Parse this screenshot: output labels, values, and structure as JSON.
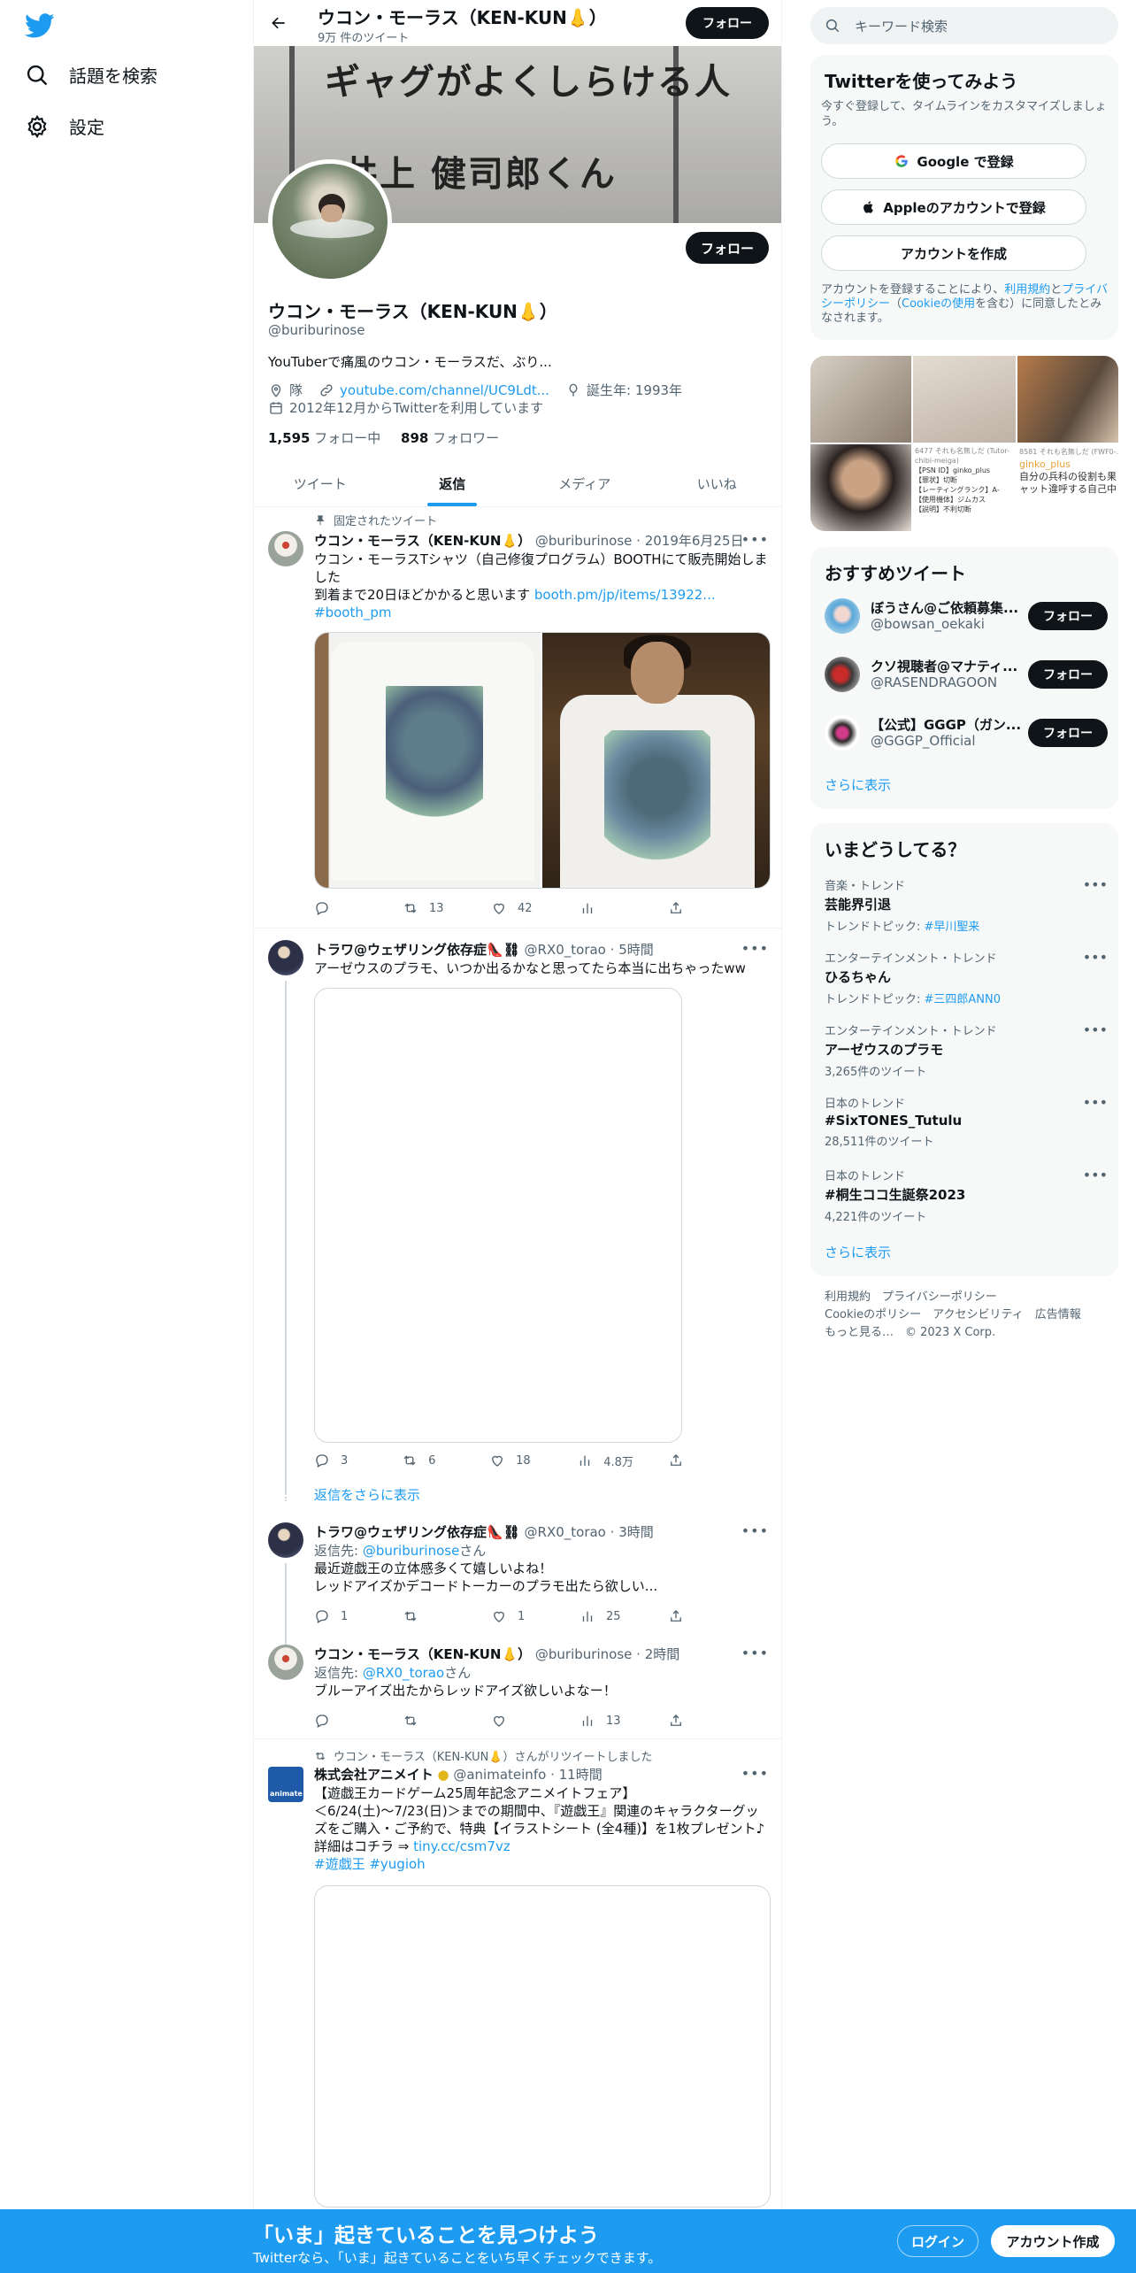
{
  "nav": {
    "explore": "話題を検索",
    "settings": "設定"
  },
  "topbar": {
    "name": "ウコン・モーラス（KEN-KUN👃）",
    "tweet_count": "9万 件のツイート",
    "follow": "フォロー"
  },
  "banner": {
    "line1": "ギャグがよくしらける人",
    "line2": "井上 健司郎くん"
  },
  "profile": {
    "follow": "フォロー",
    "name": "ウコン・モーラス（KEN-KUN👃）",
    "handle": "@buriburinose",
    "bio": "YouTuberで痛風のウコン・モーラスだ、ぶり...",
    "location": "隊",
    "url": "youtube.com/channel/UC9Ldt...",
    "birthday": "誕生年: 1993年",
    "joined": "2012年12月からTwitterを利用しています",
    "following_count": "1,595",
    "following_label": "フォロー中",
    "followers_count": "898",
    "followers_label": "フォロワー"
  },
  "tabs": [
    "ツイート",
    "返信",
    "メディア",
    "いいね"
  ],
  "tweets": [
    {
      "context": "固定されたツイート",
      "name": "ウコン・モーラス（KEN-KUN👃）",
      "handle": "@buriburinose",
      "time": "2019年6月25日",
      "text1": "ウコン・モーラスTシャツ（自己修復プログラム）BOOTHにて販売開始しました",
      "text2": "到着まで20日ほどかかると思います",
      "link": "booth.pm/jp/items/13922...",
      "hashtag": "#booth_pm",
      "reply": "",
      "retweet": "13",
      "like": "42",
      "views": ""
    },
    {
      "name": "トラワ@ウェザリング依存症👠⛓",
      "handle": "@RX0_torao",
      "time": "5時間",
      "text1": "アーゼウスのプラモ、いつか出るかなと思ってたら本当に出ちゃったww",
      "reply": "3",
      "retweet": "6",
      "like": "18",
      "views": "4.8万"
    },
    {
      "more_replies": "返信をさらに表示"
    },
    {
      "name": "トラワ@ウェザリング依存症👠⛓",
      "handle": "@RX0_torao",
      "time": "3時間",
      "reply_to_label": "返信先:",
      "reply_to": "@buriburinose",
      "reply_to_suffix": "さん",
      "text1": "最近遊戯王の立体感多くて嬉しいよね！",
      "text2": "レッドアイズかデコードトーカーのプラモ出たら欲しい...",
      "reply": "1",
      "retweet": "",
      "like": "1",
      "views": "25"
    },
    {
      "name": "ウコン・モーラス（KEN-KUN👃）",
      "handle": "@buriburinose",
      "time": "2時間",
      "reply_to_label": "返信先:",
      "reply_to": "@RX0_torao",
      "reply_to_suffix": "さん",
      "text1": "ブルーアイズ出たからレッドアイズ欲しいよなー！",
      "reply": "",
      "retweet": "",
      "like": "",
      "views": "13"
    },
    {
      "context": "ウコン・モーラス（KEN-KUN👃）さんがリツイートしました",
      "name": "株式会社アニメイト",
      "handle": "@animateinfo",
      "time": "11時間",
      "text1": "【遊戯王カードゲーム25周年記念アニメイトフェア】",
      "text2": "＜6/24(土)～7/23(日)＞までの期間中、『遊戯王』関連のキャラクターグッズをご購入・ご予約で、特典【イラストシート (全4種)】を1枚プレゼント♪",
      "text3": "詳細はコチラ ⇒",
      "link": "tiny.cc/csm7vz",
      "hashtag1": "#遊戯王",
      "hashtag2": "#yugioh"
    }
  ],
  "right": {
    "search_placeholder": "キーワード検索",
    "signup_title": "Twitterを使ってみよう",
    "signup_sub": "今すぐ登録して、タイムラインをカスタマイズしましょう。",
    "google": "Google で登録",
    "apple": "Appleのアカウントで登録",
    "create": "アカウントを作成",
    "terms_pre": "アカウントを登録することにより、",
    "terms_link": "利用規約",
    "terms_and": "と",
    "privacy_link": "プライバシーポリシー",
    "cookie_pre": "（",
    "cookie_link": "Cookieの使用",
    "terms_post": "を含む）に同意したとみなされます。",
    "media_texts": [
      "6477 それも名無しだ (Tutor-chibi-meiga)",
      "【PSN ID】ginko_plus",
      "【罪状】切断",
      "【レーティングランク】A-",
      "【使用機体】ジムカス",
      "【説明】不利切断",
      "8581 それも名無しだ (FWF0-...",
      "ginko_plus",
      "自分の兵科の役割も果",
      "ャット違呼する自己中"
    ],
    "rec_title": "おすすめツイート",
    "recs": [
      {
        "name": "ぼうさん@ご依頼募集...",
        "handle": "@bowsan_oekaki",
        "btn": "フォロー"
      },
      {
        "name": "クソ視聴者@マナティ...",
        "handle": "@RASENDRAGOON",
        "btn": "フォロー"
      },
      {
        "name": "【公式】GGGP（ガン...",
        "handle": "@GGGP_Official",
        "btn": "フォロー"
      }
    ],
    "show_more": "さらに表示",
    "trends_title": "いまどうしてる？",
    "trends": [
      {
        "cat": "音楽・トレンド",
        "name": "芸能界引退",
        "extra_label": "トレンドトピック: ",
        "extra_link": "#早川聖来"
      },
      {
        "cat": "エンターテインメント・トレンド",
        "name": "ひるちゃん",
        "extra_label": "トレンドトピック: ",
        "extra_link": "#三四郎ANN0"
      },
      {
        "cat": "エンターテインメント・トレンド",
        "name": "アーゼウスのプラモ",
        "extra_label": "3,265件のツイート",
        "extra_link": ""
      },
      {
        "cat": "日本のトレンド",
        "name": "#SixTONES_Tutulu",
        "extra_label": "28,511件のツイート",
        "extra_link": ""
      },
      {
        "cat": "日本のトレンド",
        "name": "#桐生ココ生誕祭2023",
        "extra_label": "4,221件のツイート",
        "extra_link": ""
      }
    ],
    "footer1": "利用規約　プライバシーポリシー",
    "footer2": "Cookieのポリシー　アクセシビリティ　広告情報",
    "footer3": "もっと見る…　© 2023 X Corp."
  },
  "bottom": {
    "title": "「いま」起きていることを見つけよう",
    "sub": "Twitterなら、「いま」起きていることをいち早くチェックできます。",
    "login": "ログイン",
    "signup": "アカウント作成"
  },
  "colors": {
    "accent": "#1d9bf0",
    "text": "#0f1419",
    "muted": "#536471"
  }
}
